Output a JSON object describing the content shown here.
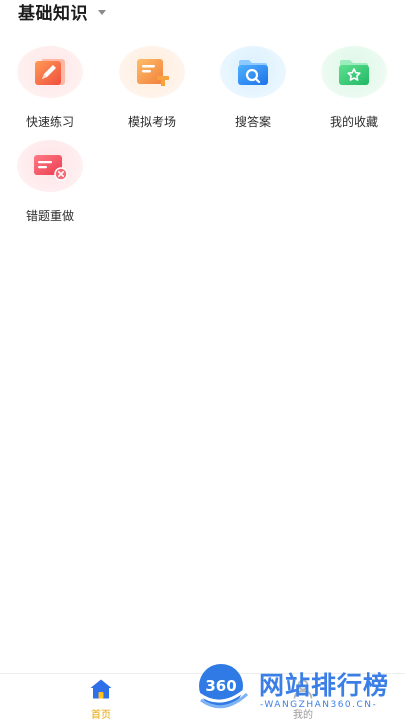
{
  "header": {
    "title": "基础知识"
  },
  "tiles": [
    {
      "label": "快速练习",
      "icon": "pencil-note-icon",
      "color": "#f2604a"
    },
    {
      "label": "模拟考场",
      "icon": "exam-podium-icon",
      "color": "#f59a3c"
    },
    {
      "label": "搜答案",
      "icon": "search-folder-icon",
      "color": "#2f8ef0"
    },
    {
      "label": "我的收藏",
      "icon": "star-folder-icon",
      "color": "#2fc275"
    },
    {
      "label": "错题重做",
      "icon": "error-card-icon",
      "color": "#f04e5e"
    }
  ],
  "tabbar": {
    "home_label": "首页",
    "mine_label": "我的",
    "active_color": "#e7a500"
  },
  "watermark": {
    "logo_text": "360",
    "cn_text": "网站排行榜",
    "en_text": "-WANGZHAN360.CN-"
  }
}
